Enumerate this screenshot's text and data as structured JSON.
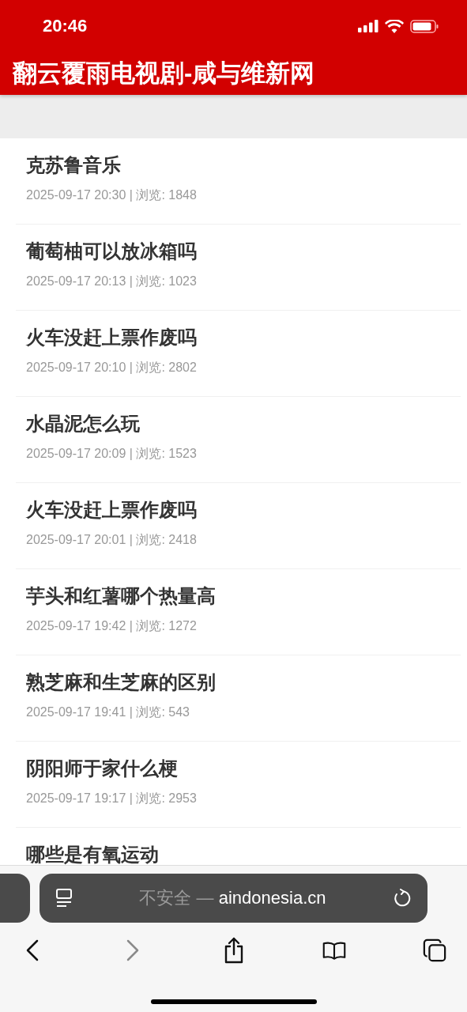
{
  "status_bar": {
    "time": "20:46"
  },
  "site_title": "翻云覆雨电视剧-咸与维新网",
  "articles": [
    {
      "title": "克苏鲁音乐",
      "meta": "2025-09-17 20:30 | 浏览: 1848"
    },
    {
      "title": "葡萄柚可以放冰箱吗",
      "meta": "2025-09-17 20:13 | 浏览: 1023"
    },
    {
      "title": "火车没赶上票作废吗",
      "meta": "2025-09-17 20:10 | 浏览: 2802"
    },
    {
      "title": "水晶泥怎么玩",
      "meta": "2025-09-17 20:09 | 浏览: 1523"
    },
    {
      "title": "火车没赶上票作废吗",
      "meta": "2025-09-17 20:01 | 浏览: 2418"
    },
    {
      "title": "芋头和红薯哪个热量高",
      "meta": "2025-09-17 19:42 | 浏览: 1272"
    },
    {
      "title": "熟芝麻和生芝麻的区别",
      "meta": "2025-09-17 19:41 | 浏览: 543"
    },
    {
      "title": "阴阳师于家什么梗",
      "meta": "2025-09-17 19:17 | 浏览: 2953"
    },
    {
      "title": "哪些是有氧运动"
    }
  ],
  "browser": {
    "security": "不安全 —",
    "domain": "aindonesia.cn",
    "toolbar": [
      {
        "kind": "back",
        "disabled": false
      },
      {
        "kind": "forward",
        "disabled": true
      },
      {
        "kind": "share",
        "disabled": false
      },
      {
        "kind": "bookmarks",
        "disabled": false
      },
      {
        "kind": "tabs",
        "disabled": false
      }
    ]
  }
}
